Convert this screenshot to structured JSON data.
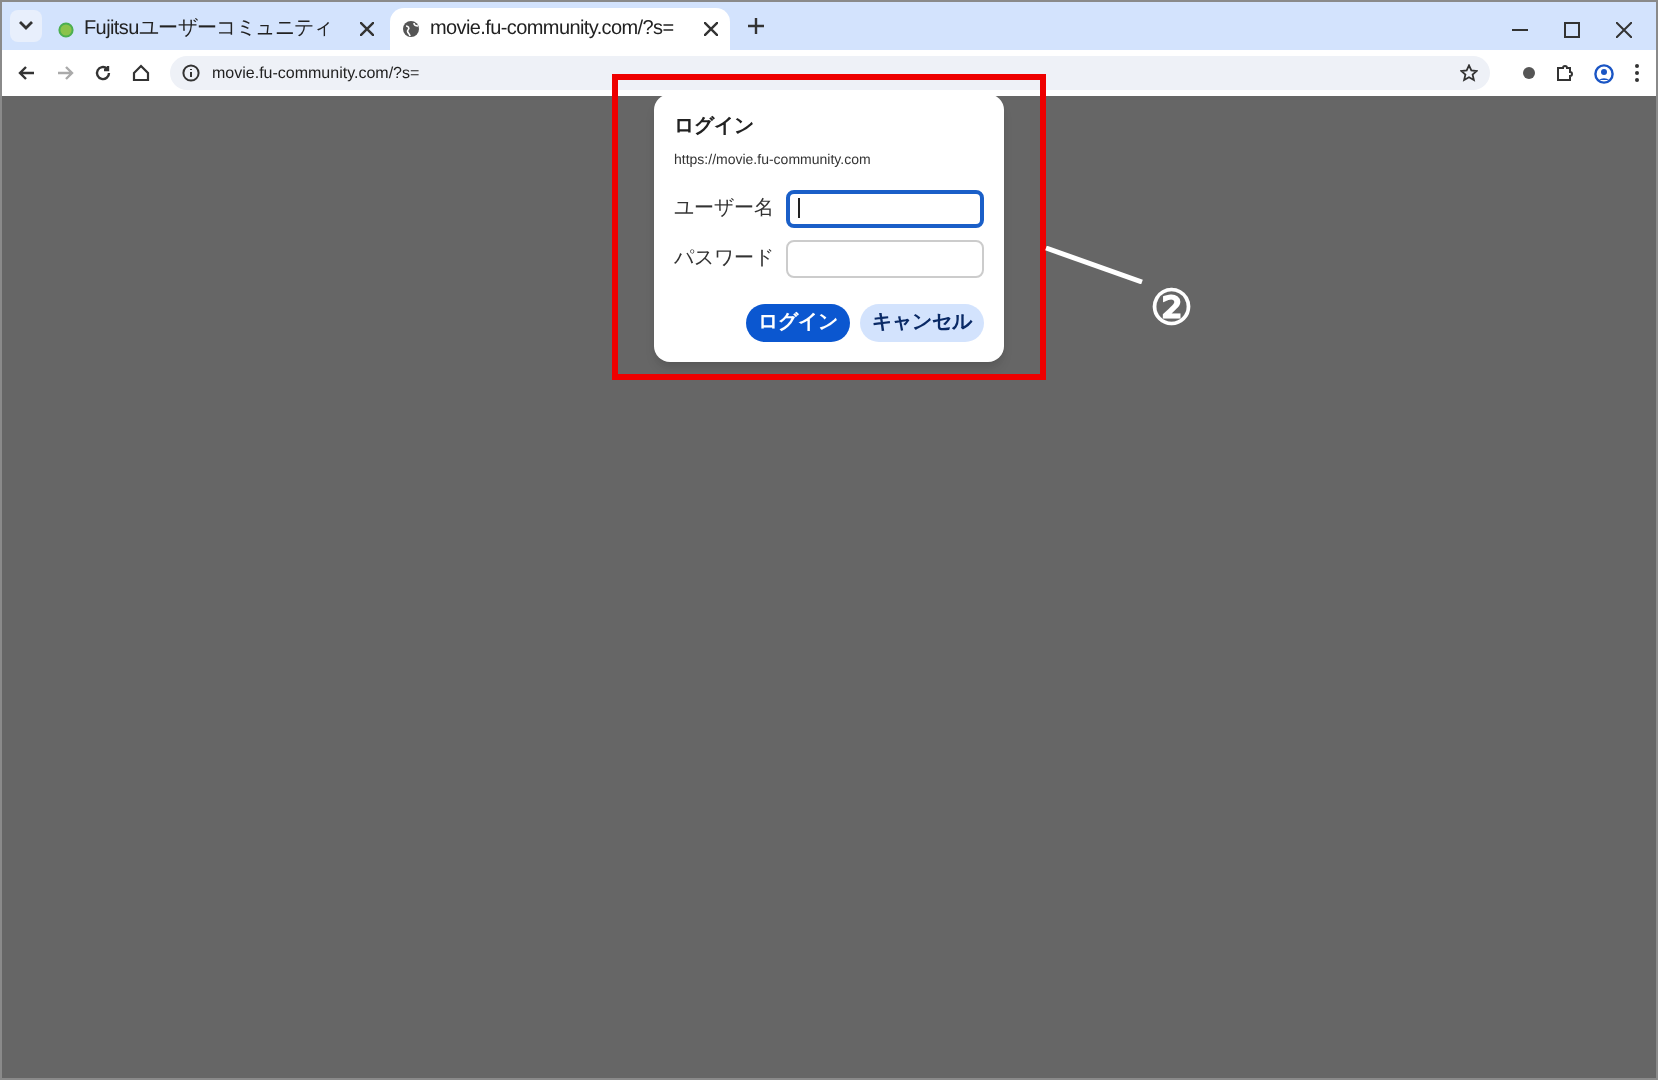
{
  "tabs": [
    {
      "title": "Fujitsuユーザーコミュニティ",
      "kind": "site",
      "selected": false
    },
    {
      "title": "movie.fu-community.com/?s=",
      "kind": "web",
      "selected": true
    }
  ],
  "address_bar": {
    "url": "movie.fu-community.com/?s="
  },
  "dialog": {
    "title": "ログイン",
    "origin": "https://movie.fu-community.com",
    "fields": [
      {
        "label": "ユーザー名",
        "focused": true
      },
      {
        "label": "パスワード",
        "focused": false
      }
    ],
    "buttons": [
      {
        "label": "ログイン",
        "kind": "primary"
      },
      {
        "label": "キャンセル",
        "kind": "secondary"
      }
    ]
  },
  "annotation": {
    "label": "②"
  }
}
